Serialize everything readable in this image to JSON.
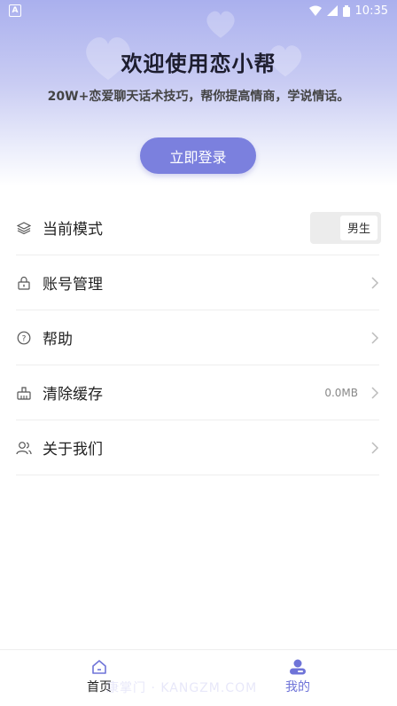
{
  "status_bar": {
    "time": "10:35",
    "left_badge": "A"
  },
  "header": {
    "title": "欢迎使用恋小帮",
    "subtitle": "20W+恋爱聊天话术技巧，帮你提高情商，学说情话。",
    "login_label": "立即登录"
  },
  "menu": {
    "mode": {
      "label": "当前模式",
      "toggle_value": "男生"
    },
    "account": {
      "label": "账号管理"
    },
    "help": {
      "label": "帮助"
    },
    "cache": {
      "label": "清除缓存",
      "value": "0.0MB"
    },
    "about": {
      "label": "关于我们"
    }
  },
  "tabbar": {
    "home": {
      "label": "首页"
    },
    "mine": {
      "label": "我的"
    }
  },
  "watermark": "康掌门 · KANGZM.COM",
  "colors": {
    "accent": "#7b80de",
    "active_tab": "#6f74d8"
  }
}
